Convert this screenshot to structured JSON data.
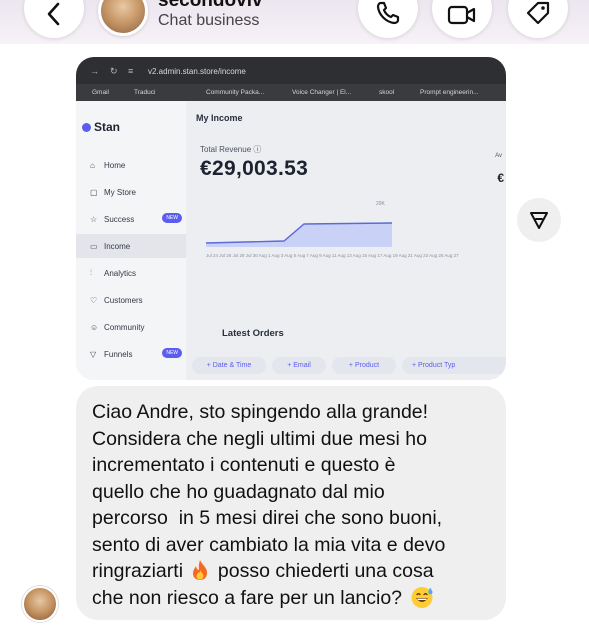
{
  "header": {
    "contact_name": "secondoviv",
    "contact_subtitle": "Chat business"
  },
  "shared_image": {
    "url": "v2.admin.stan.store/income",
    "bookmarks": [
      "Gmail",
      "Traduci",
      "Community Packa...",
      "Voice Changer | El...",
      "skool",
      "Prompt engineerin..."
    ],
    "logo": "Stan",
    "sidebar": [
      {
        "label": "Home",
        "icon": "home-icon"
      },
      {
        "label": "My Store",
        "icon": "store-icon"
      },
      {
        "label": "Success",
        "icon": "star-icon",
        "badge": "NEW"
      },
      {
        "label": "Income",
        "icon": "wallet-icon",
        "active": true
      },
      {
        "label": "Analytics",
        "icon": "analytics-icon"
      },
      {
        "label": "Customers",
        "icon": "heart-icon"
      },
      {
        "label": "Community",
        "icon": "people-icon"
      },
      {
        "label": "Funnels",
        "icon": "funnel-icon",
        "badge": "NEW"
      }
    ],
    "page_title": "My Income",
    "total_revenue_label": "Total Revenue",
    "total_revenue": "€29,003.53",
    "chart_peak_label": "29K",
    "chart_dates": "Jul 24 Jul 26 Jul 28 Jul 30 Aug 1 Aug 3 Aug 5 Aug 7 Aug 9 Aug 11 Aug 13 Aug 15 Aug 17 Aug 19 Aug 21 Aug 23 Aug 25 Aug 27",
    "side_label": "Av",
    "side_value": "€",
    "latest_orders": "Latest Orders",
    "filters": [
      "+ Date & Time",
      "+ Email",
      "+ Product",
      "+ Product Typ"
    ]
  },
  "message": {
    "text_part1": "Ciao Andre, sto spingendo alla grande!\nConsidera che negli ultimi due mesi ho\nincrementato i contenuti e questo è\nquello che ho guadagnato dal mio\npercorso  in 5 mesi direi che sono buoni,\nsento di aver cambiato la mia vita e devo\nringraziarti",
    "text_part2": "posso chiederti una cosa\nche non riesco a fare per un lancio?",
    "emoji1": "fire-emoji",
    "emoji2": "grinning-sweat-emoji"
  },
  "colors": {
    "accent": "#5b5cf0",
    "bubble": "#efefef"
  }
}
